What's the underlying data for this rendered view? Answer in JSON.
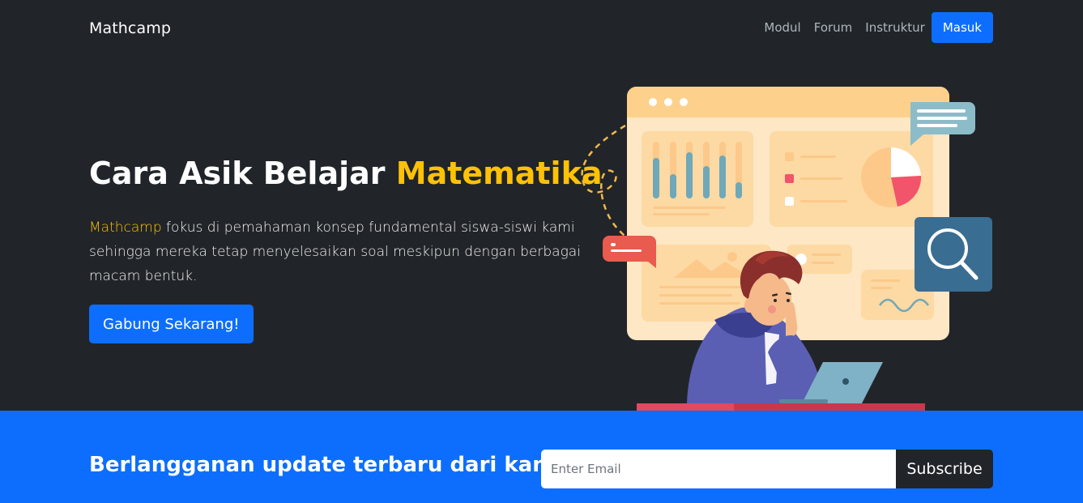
{
  "navbar": {
    "brand": "Mathcamp",
    "links": [
      "Modul",
      "Forum",
      "Instruktur"
    ],
    "login_label": "Masuk"
  },
  "hero": {
    "title_prefix": "Cara Asik Belajar ",
    "title_accent": "Matematika",
    "desc_accent": "Mathcamp",
    "desc_rest": " fokus di pemahaman konsep fundamental siswa-siswi kami sehingga mereka tetap menyelesaikan soal meskipun dengan berbagai macam bentuk.",
    "cta_label": "Gabung Sekarang!"
  },
  "newsletter": {
    "title": "Berlangganan update terbaru dari kami",
    "email_placeholder": "Enter Email",
    "subscribe_label": "Subscribe"
  },
  "colors": {
    "background": "#212529",
    "primary": "#0d6efd",
    "accent": "#ffc107"
  },
  "icons": [
    "search-icon",
    "chat-bubble-icon",
    "pie-chart-icon",
    "bar-chart-icon",
    "laptop-icon"
  ]
}
